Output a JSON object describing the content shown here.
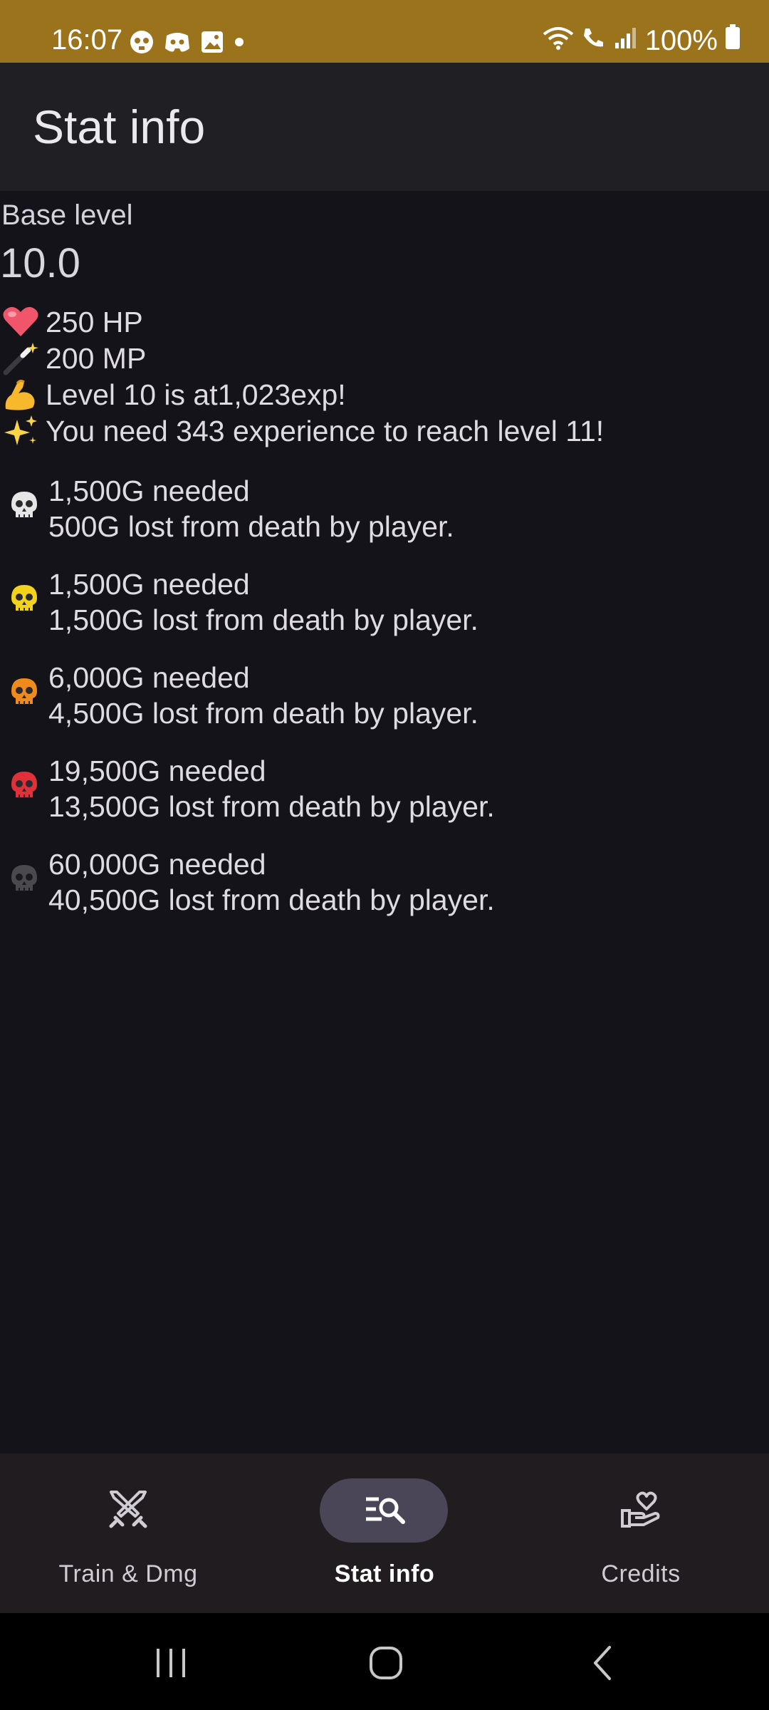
{
  "status_bar": {
    "time": "16:07",
    "battery": "100%",
    "icons": [
      "skull-notification-icon",
      "discord-icon",
      "image-icon",
      "dot-icon",
      "wifi-icon",
      "wifi-call-icon",
      "signal-icon",
      "battery-icon"
    ]
  },
  "app_bar": {
    "title": "Stat info"
  },
  "stats": {
    "base_label": "Base level",
    "base_value": "10.0",
    "lines": [
      {
        "icon": "heart-icon",
        "text": "250 HP"
      },
      {
        "icon": "magic-wand-icon",
        "text": "200 MP"
      },
      {
        "icon": "flexed-biceps-icon",
        "text": "Level 10 is at1,023exp!"
      },
      {
        "icon": "sparkles-icon",
        "text": "You need 343 experience to reach level 11!"
      }
    ]
  },
  "kill_tiers": [
    {
      "icon": "skull-white-icon",
      "color": "#e6e6e6",
      "needed": "1,500G needed",
      "lost": "500G lost from death by player."
    },
    {
      "icon": "skull-yellow-icon",
      "color": "#f2d21a",
      "needed": "1,500G needed",
      "lost": "1,500G lost from death by player."
    },
    {
      "icon": "skull-orange-icon",
      "color": "#f08a1a",
      "needed": "6,000G needed",
      "lost": "4,500G lost from death by player."
    },
    {
      "icon": "skull-red-icon",
      "color": "#e0303a",
      "needed": "19,500G needed",
      "lost": "13,500G lost from death by player."
    },
    {
      "icon": "skull-dark-icon",
      "color": "#4a4a4e",
      "needed": "60,000G needed",
      "lost": "40,500G lost from death by player."
    }
  ],
  "bottom_nav": [
    {
      "label": "Train & Dmg",
      "icon": "crossed-swords-icon",
      "active": false
    },
    {
      "label": "Stat info",
      "icon": "search-list-icon",
      "active": true
    },
    {
      "label": "Credits",
      "icon": "heart-hand-icon",
      "active": false
    }
  ],
  "system_nav": [
    "recents-button",
    "home-button",
    "back-button"
  ]
}
